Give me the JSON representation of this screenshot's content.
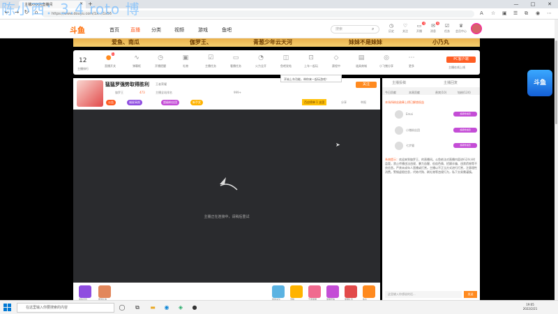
{
  "watermark": "陈小西：3.4 roto 博",
  "browser": {
    "tab_title": "主播XXX的直播间",
    "url": "https://www.douyu.com/1x.../1x56",
    "new_tab": "+",
    "minimize": "—",
    "maximize": "□",
    "close": "✕"
  },
  "site": {
    "logo": "斗鱼",
    "nav": [
      "首页",
      "直播",
      "分类",
      "视频",
      "游戏",
      "鱼吧"
    ],
    "search_placeholder": "搜索",
    "header_icons": [
      {
        "label": "历史",
        "badge": ""
      },
      {
        "label": "关注",
        "badge": ""
      },
      {
        "label": "开播",
        "badge": "4"
      },
      {
        "label": "消息",
        "badge": "6"
      },
      {
        "label": "任务",
        "badge": ""
      },
      {
        "label": "会员中心",
        "badge": ""
      }
    ]
  },
  "banner": {
    "items": [
      "爱鱼、南瓜",
      "伽罗王、",
      "青葱少年云天河",
      "妹妹不是妹妹",
      "小乃丸"
    ]
  },
  "toolbar": {
    "count": "12",
    "count_label": "主播排行",
    "badge": "1",
    "items": [
      "直播开关",
      "弹幕框",
      "开播提醒",
      "礼物",
      "主播任务",
      "看播任务",
      "火力全开",
      "鱼吧发帖",
      "上车一起玩",
      "赛程中",
      "道具商城",
      "小飞猪分享",
      "更多"
    ],
    "pc_button": "PC客户端",
    "pc_sub": "主播在线上线"
  },
  "tooltip": "开始上车功能，带你来一起玩游戏！",
  "room": {
    "title": "猛猛罗强势取得胜利",
    "category": "王者荣耀",
    "streamer": "伽罗王",
    "hot": "473",
    "rank_text": "主播全站排名",
    "fans": "999+",
    "follow": "关注",
    "rank_tag": "百应榜单 1 支团",
    "tags": [
      "公告",
      "福星高照",
      "超级粉丝团",
      "新手奖"
    ],
    "share": "分享",
    "report": "举报"
  },
  "player": {
    "message": "主播正在连接中，请稍后重试"
  },
  "bottom_gifts": [
    "我的背包",
    "赠送礼物",
    "我的关注",
    "宝箱",
    "王者荣耀",
    "荣耀皮肤",
    "荣耀礼包",
    "鱼丸"
  ],
  "right_panel": {
    "tabs": [
      "今日贡献",
      "本周贡献",
      "贵宾(10)",
      "钻粉(124)"
    ],
    "header": "主播投稿",
    "header2": "主播回复",
    "notice": "本场所粉丝勋章上榜已解锁权益",
    "ranks": [
      {
        "name": "Emai",
        "btn": "超级粉丝团"
      },
      {
        "name": "小猪粉丝团",
        "btn": "超级粉丝团"
      },
      {
        "name": "七步猫",
        "btn": "超级粉丝团"
      }
    ],
    "system_label": "系统提示：",
    "system_msg": "欢迎来到伽罗王、的直播间。斗鱼依法对直播内容进行24小时监管，禁止传播违法违规、暴力血腥、低俗色情、招嫖诈骗、违禁药物等不良信息。严禁未成年人直播或打赏。主播以不正当方式进行打赏，注意理性消费。警惕虚假信息，代练代购、刷礼物等违规行为，私下交易需谨慎。",
    "input_placeholder": "这里输入你想说的话...",
    "send": "发送"
  },
  "taskbar": {
    "search_placeholder": "在这里输入你要搜索的内容",
    "time": "19:05",
    "date": "2022/2/21"
  },
  "promo": "斗鱼"
}
